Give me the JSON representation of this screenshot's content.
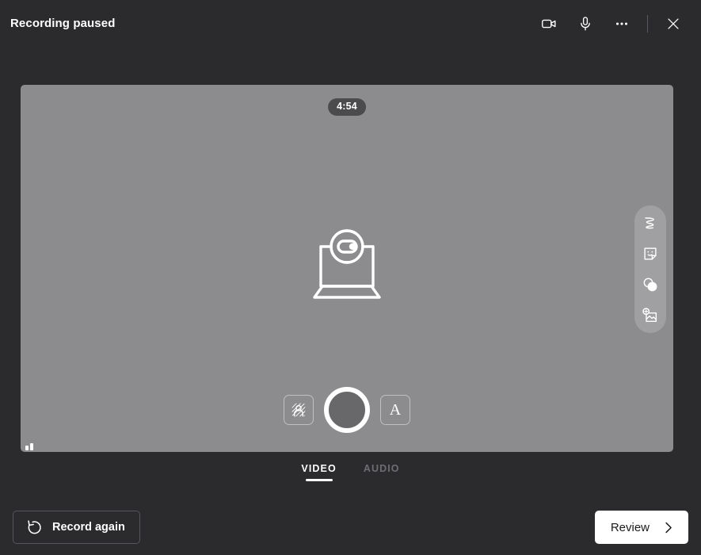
{
  "window": {
    "title": "Recording paused",
    "background_color": "#2b2b2e"
  },
  "header": {
    "actions": [
      {
        "name": "camera-icon",
        "label": "Camera"
      },
      {
        "name": "microphone-icon",
        "label": "Microphone"
      },
      {
        "name": "more-options-icon",
        "label": "More options"
      },
      {
        "name": "close-icon",
        "label": "Close"
      }
    ]
  },
  "stage": {
    "timer": "4:54",
    "background_color": "#8c8c8e",
    "placeholder_icon": "laptop-screenshare-icon",
    "level_meter": "audio-level-meter"
  },
  "side_toolbar": {
    "items": [
      {
        "name": "ink-icon",
        "label": "Ink"
      },
      {
        "name": "sticker-icon",
        "label": "Stickers"
      },
      {
        "name": "filters-icon",
        "label": "Filters"
      },
      {
        "name": "add-image-icon",
        "label": "Add image"
      }
    ]
  },
  "capture_controls": {
    "background_effects": {
      "name": "background-effects-icon",
      "label": "Background effects"
    },
    "record": {
      "name": "record-button",
      "label": "Record"
    },
    "text": {
      "name": "text-tool-icon",
      "label": "A"
    }
  },
  "tabs": [
    {
      "label": "VIDEO",
      "active": true
    },
    {
      "label": "AUDIO",
      "active": false
    }
  ],
  "footer": {
    "record_again_label": "Record again",
    "review_label": "Review"
  }
}
